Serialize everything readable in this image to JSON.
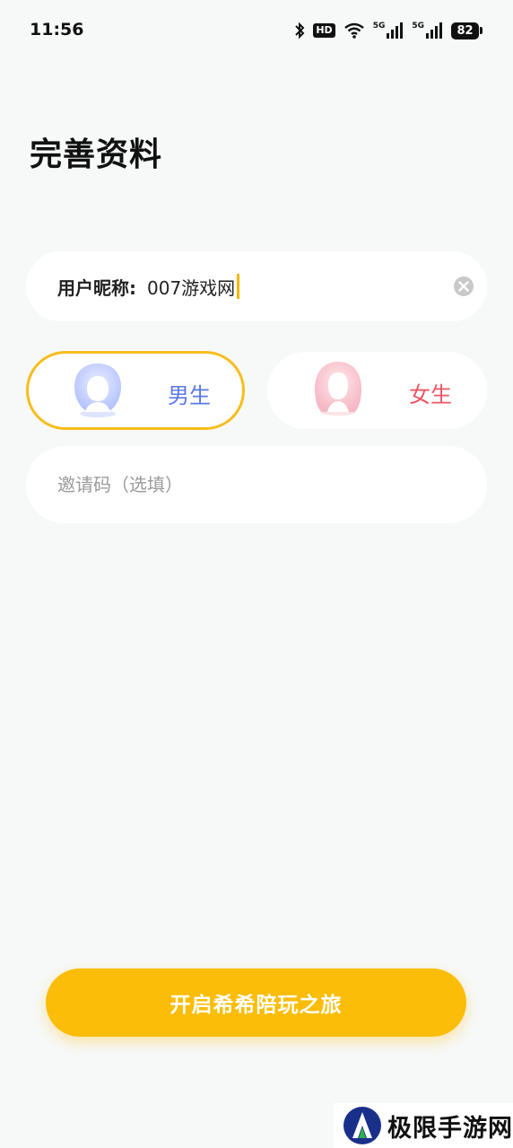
{
  "status_bar": {
    "time": "11:56",
    "hd_label": "HD",
    "network_label": "5G",
    "battery": "82",
    "icons": [
      "bluetooth-icon",
      "hd-icon",
      "wifi-icon",
      "signal-5g-icon",
      "signal-5g-icon",
      "battery-icon"
    ]
  },
  "page": {
    "title": "完善资料"
  },
  "nickname": {
    "label": "用户昵称:",
    "value": "007游戏网",
    "clear_icon": "clear-icon"
  },
  "gender": {
    "male_label": "男生",
    "female_label": "女生",
    "selected": "male",
    "male_color": "#5b78e6",
    "female_color": "#ec5664",
    "selected_border_color": "#f7bd1b"
  },
  "invite": {
    "placeholder": "邀请码（选填）",
    "value": ""
  },
  "submit": {
    "label": "开启希希陪玩之旅",
    "color": "#fbbd08"
  },
  "watermark": {
    "text": "极限手游网"
  }
}
